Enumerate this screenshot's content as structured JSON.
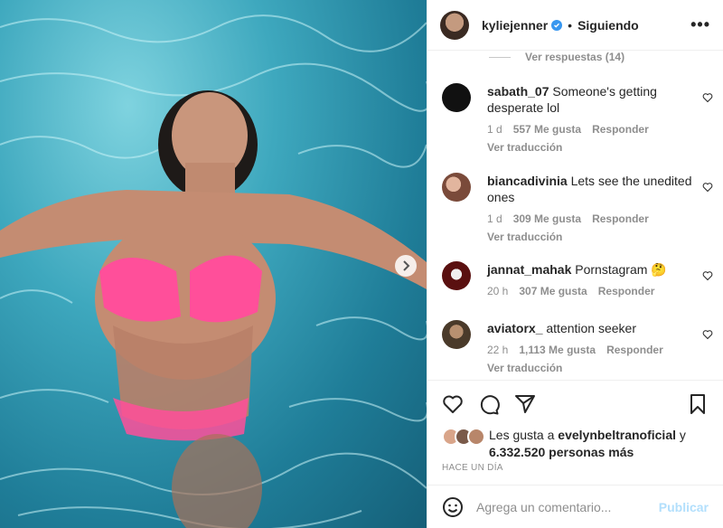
{
  "post": {
    "username": "kyliejenner",
    "separator": "•",
    "follow_status": "Siguiendo",
    "more": "•••"
  },
  "comments": {
    "view_replies": "Ver respuestas (14)",
    "items": [
      {
        "user": "sabath_07",
        "text": "Someone's getting desperate lol",
        "time": "1 d",
        "likes": "557 Me gusta",
        "reply": "Responder",
        "translate": "Ver traducción",
        "avatar_color": "#111111"
      },
      {
        "user": "biancadivinia",
        "text": "Lets see the unedited ones",
        "time": "1 d",
        "likes": "309 Me gusta",
        "reply": "Responder",
        "translate": "Ver traducción",
        "avatar_color": "#7a4a3a"
      },
      {
        "user": "jannat_mahak",
        "text": "Pornstagram 🤔",
        "time": "20 h",
        "likes": "307 Me gusta",
        "reply": "Responder",
        "translate": "",
        "avatar_color": "#5a1010"
      },
      {
        "user": "aviatorx_",
        "text": "attention seeker",
        "time": "22 h",
        "likes": "1,113 Me gusta",
        "reply": "Responder",
        "translate": "Ver traducción",
        "avatar_color": "#4a3a2a"
      }
    ]
  },
  "likes": {
    "prefix": "Les gusta a",
    "first_user": "evelynbeltranoficial",
    "conjunction": "y",
    "others": "6.332.520 personas más"
  },
  "timestamp": "HACE UN DÍA",
  "composer": {
    "placeholder": "Agrega un comentario...",
    "publish": "Publicar"
  },
  "icons": {
    "like": "heart-icon",
    "comment": "comment-icon",
    "share": "share-icon",
    "save": "bookmark-icon",
    "emoji": "emoji-icon",
    "next": "chevron-right-icon"
  },
  "colors": {
    "verified": "#3897f0",
    "muted": "#8e8e8e",
    "publish_disabled": "#b2dffc",
    "bikini": "#ff4f9a",
    "water": "#3ea8be"
  }
}
